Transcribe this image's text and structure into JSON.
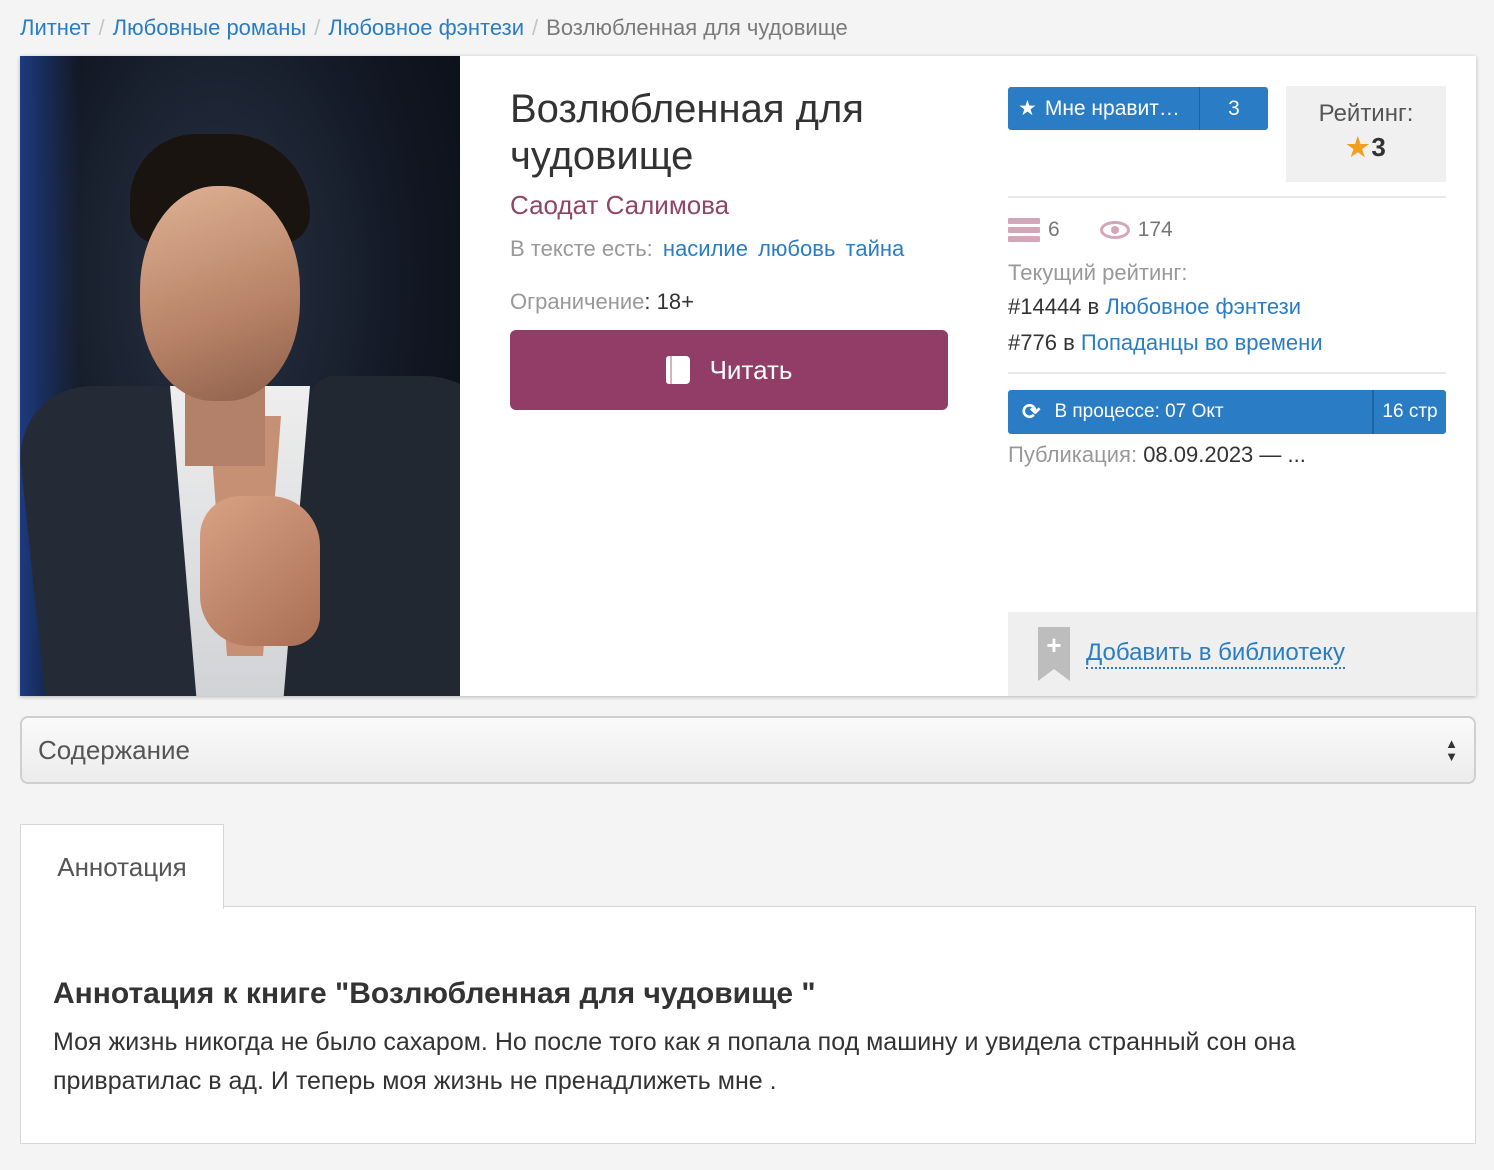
{
  "breadcrumb": {
    "items": [
      "Литнет",
      "Любовные романы",
      "Любовное фэнтези"
    ],
    "current": "Возлюбленная для чудовище",
    "separator": "/"
  },
  "book": {
    "title": "Возлюбленная для чудовище",
    "author": "Саодат Салимова",
    "tags_label": "В тексте есть:",
    "tags": [
      "насилие",
      "любовь",
      "тайна"
    ],
    "limit_label": "Ограничение",
    "limit_value": "18+",
    "read_label": "Читать"
  },
  "like": {
    "label": "Мне нравит…",
    "count": "3",
    "icon": "star-icon"
  },
  "rating": {
    "label": "Рейтинг:",
    "value": "3",
    "star_color": "#f0a020"
  },
  "stats": {
    "libraries": "6",
    "views": "174"
  },
  "current_rating": {
    "label": "Текущий рейтинг:",
    "ranks": [
      {
        "rank": "#14444",
        "prep": "в",
        "category": "Любовное фэнтези"
      },
      {
        "rank": "#776",
        "prep": "в",
        "category": "Попаданцы во времени"
      }
    ]
  },
  "status": {
    "label": "В процессе: 07 Окт",
    "pages": "16 стр",
    "icon": "refresh-icon"
  },
  "publication": {
    "label": "Публикация:",
    "value": "08.09.2023 — ..."
  },
  "library": {
    "label": "Добавить в библиотеку",
    "icon": "bookmark-plus-icon"
  },
  "contents": {
    "label": "Содержание"
  },
  "tabs": [
    {
      "label": "Аннотация"
    }
  ],
  "annotation": {
    "heading": "Аннотация к книге \"Возлюбленная для чудовище \"",
    "text": "Моя жизнь никогда не было сахаром. Но после того как я попала под машину и увидела странный сон она привратилас в ад. И теперь моя жизнь не пренадлижеть мне ."
  },
  "colors": {
    "accent_blue": "#2a7dc4",
    "read_button": "#923d67",
    "author": "#8e4668"
  }
}
